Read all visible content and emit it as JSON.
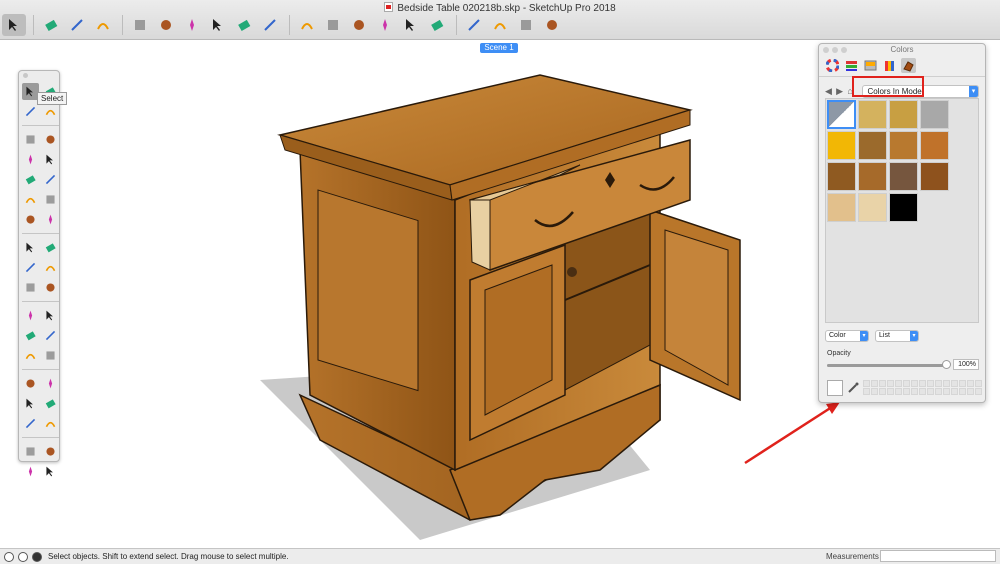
{
  "window": {
    "title": "Bedside Table 020218b.skp - SketchUp Pro 2018"
  },
  "toolbar": {
    "buttons": [
      {
        "icon": "select-icon"
      },
      {
        "icon": "eraser-icon"
      },
      {
        "icon": "line-icon"
      },
      {
        "icon": "arc-icon"
      },
      {
        "icon": "shapes-icon"
      },
      {
        "icon": "push-pull-icon"
      },
      {
        "icon": "offset-icon"
      },
      {
        "icon": "move-icon"
      },
      {
        "icon": "rotate-icon"
      },
      {
        "icon": "scale-icon"
      },
      {
        "icon": "text-icon"
      },
      {
        "icon": "paint-bucket-icon"
      },
      {
        "icon": "orbit-icon"
      },
      {
        "icon": "pan-icon"
      },
      {
        "icon": "zoom-icon"
      },
      {
        "icon": "zoom-extents-icon"
      },
      {
        "icon": "3d-warehouse-icon"
      },
      {
        "icon": "extension-warehouse-icon"
      },
      {
        "icon": "layout-icon"
      },
      {
        "icon": "extension-manager-icon"
      }
    ]
  },
  "scene_tab": {
    "label": "Scene 1"
  },
  "tooltip": {
    "text": "Select"
  },
  "colors_panel": {
    "title": "Colors",
    "library": "Colors In Model",
    "swatches": [
      "#9aa4b0",
      "#d4b25e",
      "#c89f42",
      "#a8a8a8",
      "#f2b705",
      "#9b6a2c",
      "#b8792f",
      "#c0722a",
      "#8f5a21",
      "#a66a2a",
      "#76563e",
      "#8e521d",
      "#e2c08c",
      "#e9d3a8",
      "#000000"
    ],
    "mode_dropdown": "Color",
    "view_dropdown": "List",
    "opacity_label": "Opacity",
    "opacity_value": "100%",
    "opacity": 1.0
  },
  "status": {
    "message": "Select objects. Shift to extend select. Drag mouse to select multiple.",
    "measurements_label": "Measurements"
  },
  "colors": {
    "accent": "#3e8ef5",
    "annotation_red": "#e0221c",
    "wood": "#b9762a"
  }
}
